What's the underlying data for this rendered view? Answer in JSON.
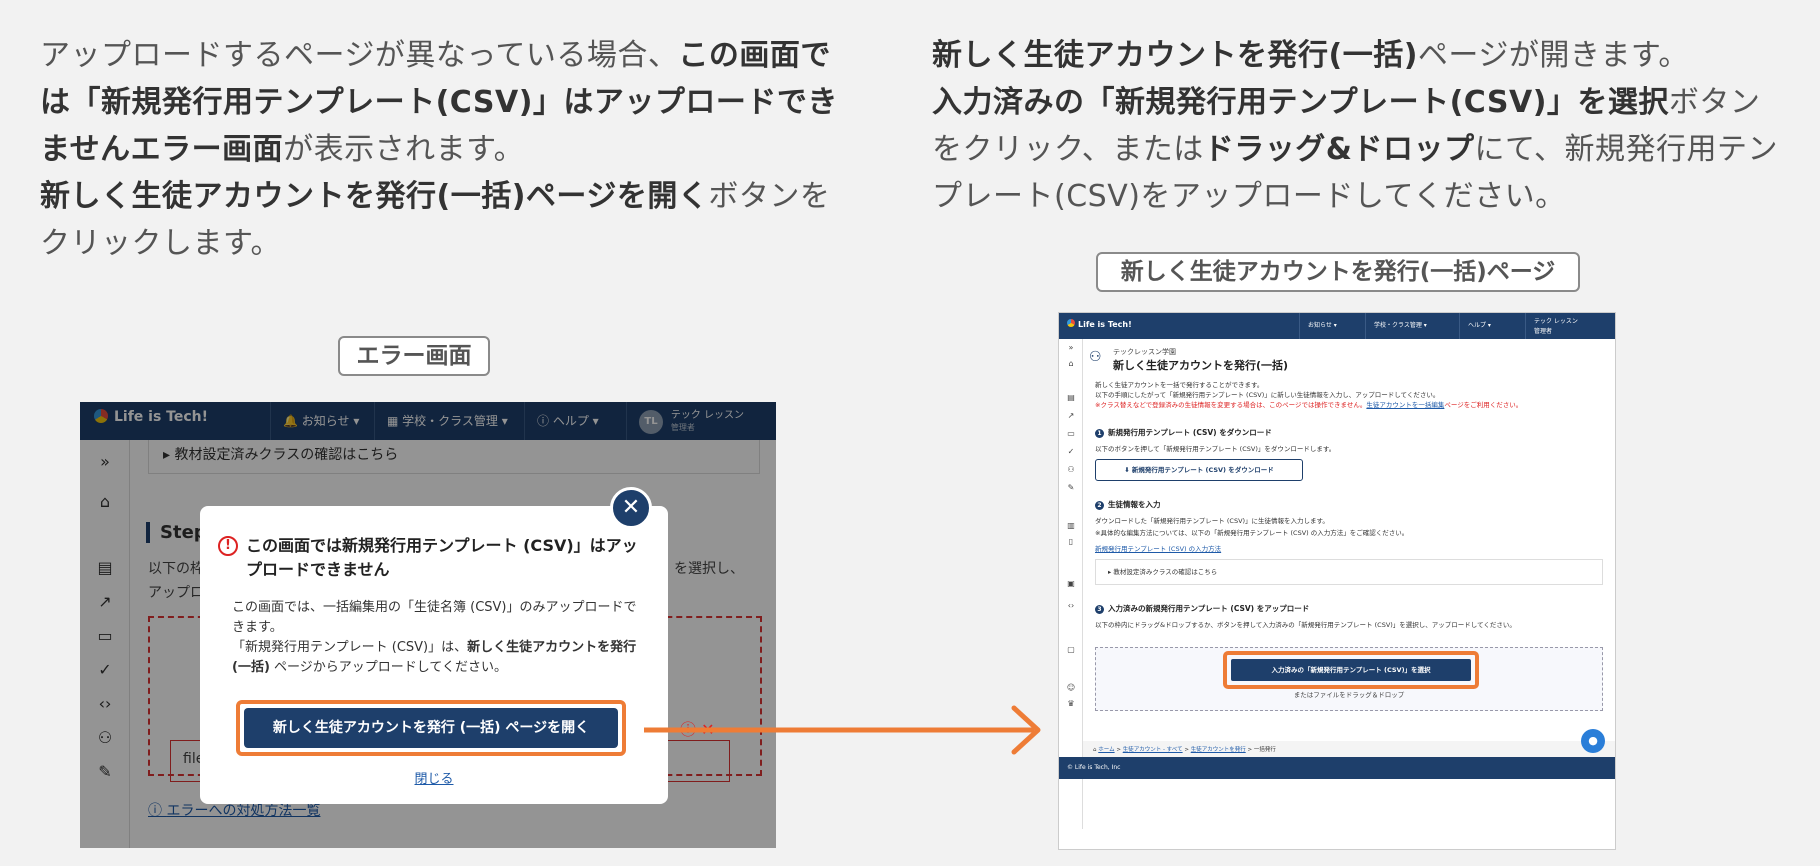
{
  "desc_left": {
    "part1": "アップロードするページが異なっている場合、",
    "part2_bold": "この画面では「新規発行用テンプレート(CSV)」はアップロードできませんエラー画面",
    "part3": "が表示されます。",
    "part4_bold": "新しく生徒アカウントを発行(一括)ページを開く",
    "part5": "ボタンをクリックします。"
  },
  "desc_right": {
    "part1_bold": "新しく生徒アカウントを発行(一括)",
    "part2": "ページが開きます。",
    "part3_bold": "入力済みの「新規発行用テンプレート(CSV)」を選択",
    "part4": "ボタンをクリック、または",
    "part5_bold": "ドラッグ&ドロップ",
    "part6": "にて、新規発行用テンプレート(CSV)をアップロードしてください。"
  },
  "labels": {
    "error_screen": "エラー画面",
    "new_page": "新しく生徒アカウントを発行(一括)ページ"
  },
  "left_ss": {
    "logo": "Life is Tech!",
    "nav_notice": "お知らせ ▾",
    "nav_school": "学校・クラス管理 ▾",
    "nav_help": "ヘルプ ▾",
    "avatar": "TL",
    "user_name": "テック レッスン",
    "user_role": "管理者",
    "accordion": "▸ 教材設定済みクラスの確認はこちら",
    "step": "Step",
    "bg_text1": "以下の枠",
    "bg_text2": "アップロ",
    "bg_text3": "」を選択し、",
    "bg_file": "file",
    "bg_help": "エラーへの対処方法一覧",
    "modal_title": "この画面では新規発行用テンプレート (CSV)」はアップロードできません",
    "modal_body1": "この画面では、一括編集用の「生徒名簿 (CSV)」のみアップロードできます。",
    "modal_body2a": "「新規発行用テンプレート (CSV)」は、",
    "modal_body2b": "新しく生徒アカウントを発行 (一括)",
    "modal_body2c": " ページからアップロードしてください。",
    "modal_button": "新しく生徒アカウントを発行 (一括) ページを開く",
    "modal_close": "閉じる"
  },
  "right_ss": {
    "logo": "Life is Tech!",
    "nav_notice": "お知らせ ▾",
    "nav_school": "学校・クラス管理 ▾",
    "nav_help": "ヘルプ ▾",
    "user_name": "テック レッスン",
    "user_role": "管理者",
    "org": "テックレッスン学園",
    "title": "新しく生徒アカウントを発行(一括)",
    "intro1": "新しく生徒アカウントを一括で発行することができます。",
    "intro2": "以下の手順にしたがって「新規発行用テンプレート (CSV)」に新しい生徒情報を入力し、アップロードしてください。",
    "intro3": "※クラス替えなどで登録済みの生徒情報を変更する場合は、このページでは操作できません。",
    "intro3_link": "生徒アカウントを一括編集",
    "intro3_tail": "ページをご利用ください。",
    "sec1_num": "1",
    "sec1": "新規発行用テンプレート (CSV) をダウンロード",
    "sec1_text": "以下のボタンを押して「新規発行用テンプレート (CSV)」をダウンロードします。",
    "dl_button": "⬇ 新規発行用テンプレート (CSV) をダウンロード",
    "sec2_num": "2",
    "sec2": "生徒情報を入力",
    "sec2_text1": "ダウンロードした「新規発行用テンプレート (CSV)」に生徒情報を入力します。",
    "sec2_text2": "※具体的な編集方法については、以下の「新規発行用テンプレート (CSV) の入力方法」をご確認ください。",
    "sec2_link": "新規発行用テンプレート (CSV) の入力方法",
    "accordion": "▸ 教材設定済みクラスの確認はこちら",
    "sec3_num": "3",
    "sec3": "入力済みの新規発行用テンプレート (CSV) をアップロード",
    "sec3_text": "以下の枠内にドラッグ&ドロップするか、ボタンを押して入力済みの「新規発行用テンプレート (CSV)」を選択し、アップロードしてください。",
    "select_button": "入力済みの「新規発行用テンプレート (CSV)」を選択",
    "dnd": "またはファイルをドラッグ＆ドロップ",
    "bread_home": "ホーム",
    "bread_all": "生徒アカウント - すべて",
    "bread_issue": "生徒アカウントを発行",
    "bread_current": "一括発行",
    "footer": "© Life is Tech, Inc"
  },
  "colors": {
    "navy": "#1e3f6b",
    "orange": "#ee7c36",
    "error_red": "#d22222"
  }
}
